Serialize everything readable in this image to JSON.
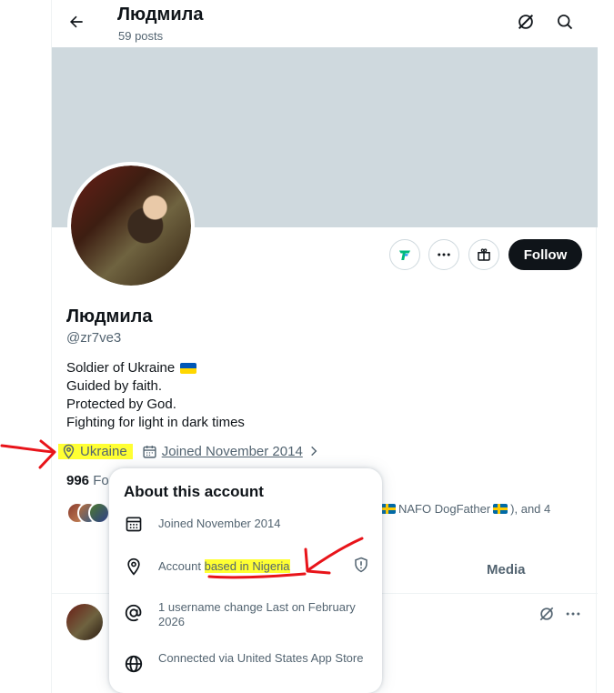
{
  "header": {
    "title": "Людмила",
    "subtitle": "59 posts",
    "back_icon": "arrow-left-icon",
    "icons": [
      "grok-icon",
      "search-icon"
    ]
  },
  "profile": {
    "name": "Людмила",
    "handle": "@zr7ve3",
    "bio": [
      "Soldier of Ukraine",
      "Guided by faith.",
      "Protected by God.",
      "Fighting for light in dark times"
    ],
    "follow_label": "Follow",
    "location": "Ukraine",
    "joined": "Joined November 2014",
    "following_count": "996",
    "following_label_partial": "Fo",
    "followed_by_partial": "NAFO DogFather",
    "followed_by_suffix": "), and 4"
  },
  "tabs": {
    "media_label": "Media"
  },
  "popover": {
    "title": "About this account",
    "items": [
      {
        "icon": "calendar-icon",
        "text": "Joined November 2014"
      },
      {
        "icon": "location-pin-icon",
        "text_prefix": "Account ",
        "text_highlight": "based in Nigeria"
      },
      {
        "icon": "at-sign-icon",
        "text": "1 username change Last on February 2026"
      },
      {
        "icon": "globe-icon",
        "text": "Connected via United States App Store"
      }
    ]
  },
  "colors": {
    "accent_dark": "#0f1419",
    "secondary_text": "#536471",
    "banner": "#cfd9de",
    "highlight": "#ffff33",
    "annotation": "#e8141a",
    "follow_icon_teal": "#00ba7c"
  }
}
